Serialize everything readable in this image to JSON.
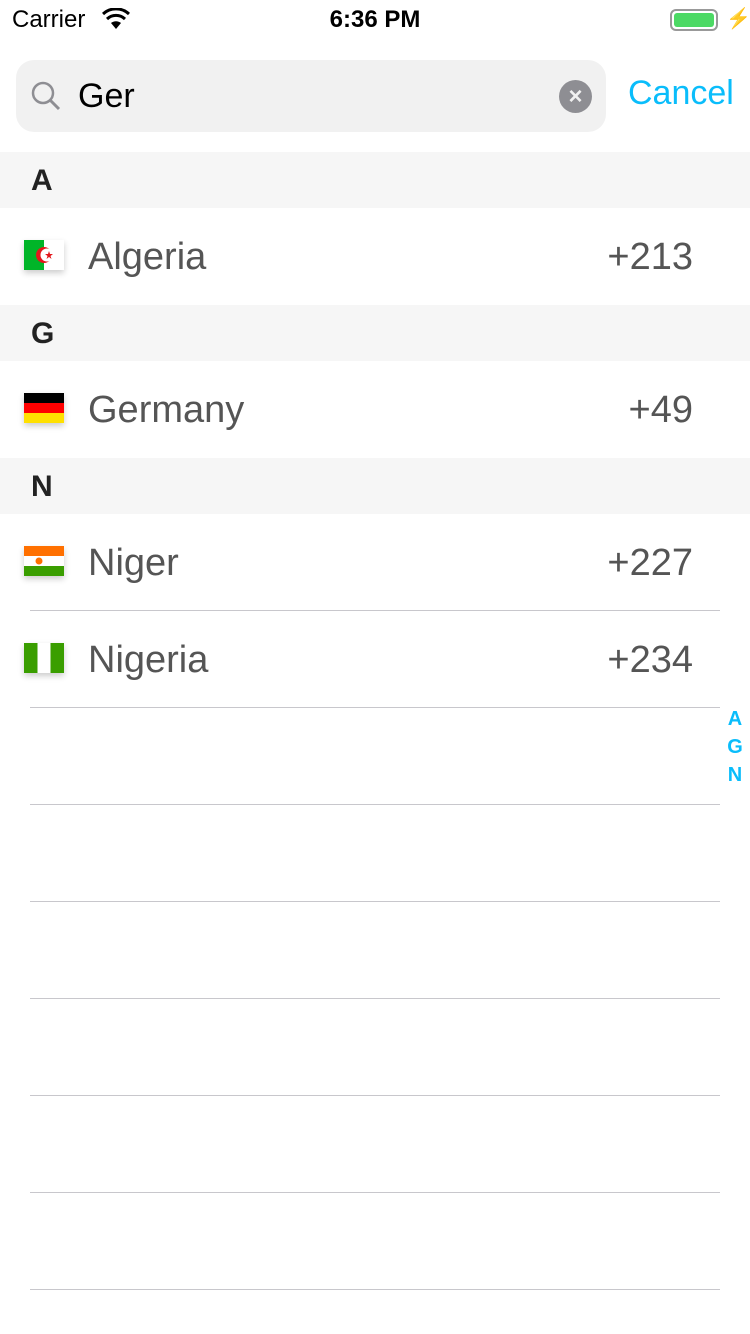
{
  "status": {
    "carrier": "Carrier",
    "time": "6:36 PM"
  },
  "search": {
    "value": "Ger",
    "cancel": "Cancel"
  },
  "sections": [
    {
      "letter": "A",
      "rows": [
        {
          "name": "Algeria",
          "code": "+213",
          "flag": "algeria"
        }
      ]
    },
    {
      "letter": "G",
      "rows": [
        {
          "name": "Germany",
          "code": "+49",
          "flag": "germany"
        }
      ]
    },
    {
      "letter": "N",
      "rows": [
        {
          "name": "Niger",
          "code": "+227",
          "flag": "niger"
        },
        {
          "name": "Nigeria",
          "code": "+234",
          "flag": "nigeria"
        }
      ]
    }
  ],
  "index": [
    "A",
    "G",
    "N"
  ],
  "colors": {
    "accent": "#0abdfb"
  }
}
